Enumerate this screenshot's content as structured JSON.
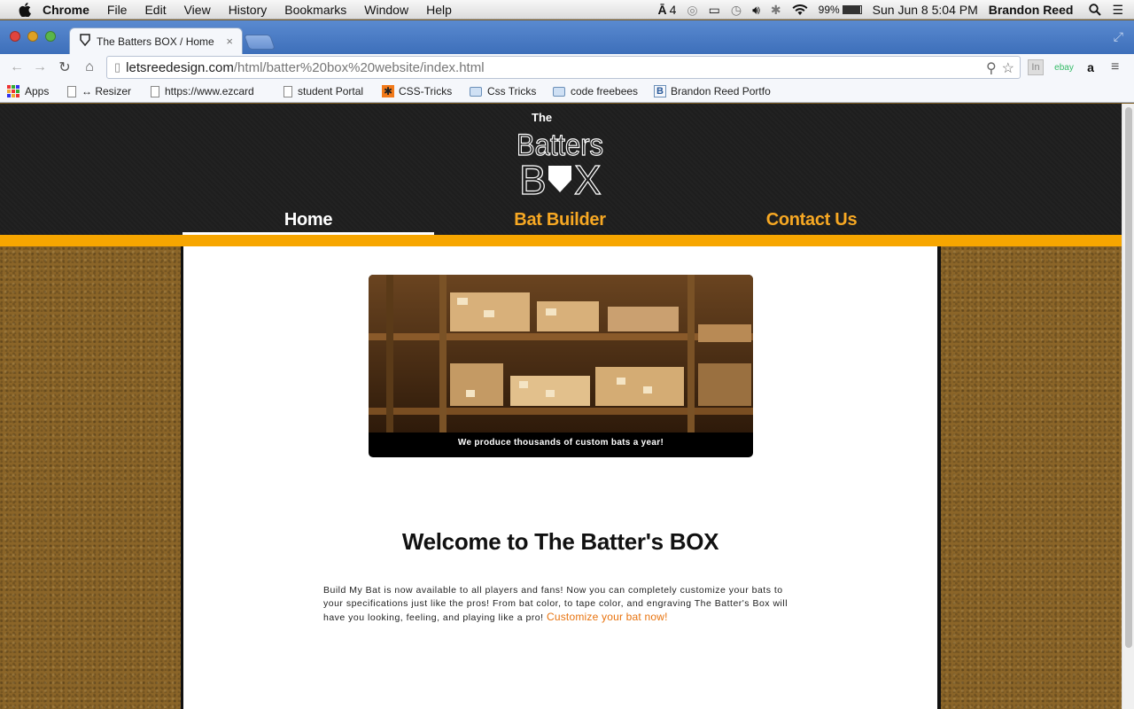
{
  "menubar": {
    "app_name": "Chrome",
    "items": [
      "File",
      "Edit",
      "View",
      "History",
      "Bookmarks",
      "Window",
      "Help"
    ],
    "adobe_count": "4",
    "battery": "99%",
    "datetime": "Sun Jun 8  5:04 PM",
    "user": "Brandon Reed"
  },
  "tab": {
    "title": "The Batters BOX / Home",
    "close": "×"
  },
  "toolbar": {
    "url_host": "letsreedesign.com",
    "url_path": "/html/batter%20box%20website/index.html",
    "ext_linkedin": "In",
    "ext_ebay": "ebay",
    "ext_amazon": "a"
  },
  "bookmarks": [
    "Apps",
    "↔ Resizer",
    "https://www.ezcard",
    "student Portal",
    "CSS-Tricks",
    "Css Tricks",
    "code freebees",
    "Brandon Reed Portfo"
  ],
  "site": {
    "logo_line1": "The",
    "logo_line2": "Batters",
    "logo_line3_a": "B",
    "logo_line3_b": "X",
    "nav": [
      "Home",
      "Bat Builder",
      "Contact Us"
    ],
    "hero_caption": "We produce thousands of custom bats a year!",
    "welcome_title": "Welcome to The Batter's BOX",
    "intro_text": "Build My Bat is now available to all players and fans! Now you can completely customize your bats to your specifications just like the pros! From bat color, to tape color, and engraving The Batter's Box will have you looking, feeling, and playing like a pro! ",
    "intro_link": "Customize your bat now!"
  },
  "colors": {
    "accent_orange": "#f7a600",
    "nav_orange": "#f7a823",
    "link_orange": "#e8730e",
    "header_dark": "#1e1e1e",
    "dirt_brown": "#8b6528"
  }
}
